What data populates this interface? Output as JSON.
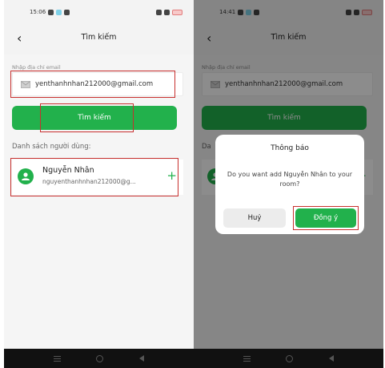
{
  "left_screen": {
    "status_time": "15:06",
    "title": "Tìm kiếm",
    "email_label": "Nhập địa chỉ email",
    "email_value": "yenthanhnhan212000@gmail.com",
    "search_button": "Tìm kiếm",
    "user_list_label": "Danh sách người dùng:",
    "user": {
      "name": "Nguyễn Nhân",
      "email": "nguyenthanhnhan212000@g..."
    }
  },
  "right_screen": {
    "status_time": "14:41",
    "title": "Tìm kiếm",
    "email_label": "Nhập địa chỉ email",
    "email_value": "yenthanhnhan212000@gmail.com",
    "search_button": "Tìm kiếm",
    "list_label_partial": "Da",
    "dialog": {
      "title": "Thông báo",
      "message": "Do you want add Nguyễn Nhân to your room?",
      "cancel": "Huỷ",
      "confirm": "Đồng ý"
    }
  },
  "colors": {
    "accent_green": "#22b14c",
    "highlight_red": "#c8302f",
    "background": "#f5f5f5"
  },
  "icons": [
    "back-arrow-icon",
    "mail-icon",
    "person-avatar-icon",
    "plus-icon",
    "menu-icon",
    "home-icon",
    "back-nav-icon"
  ]
}
